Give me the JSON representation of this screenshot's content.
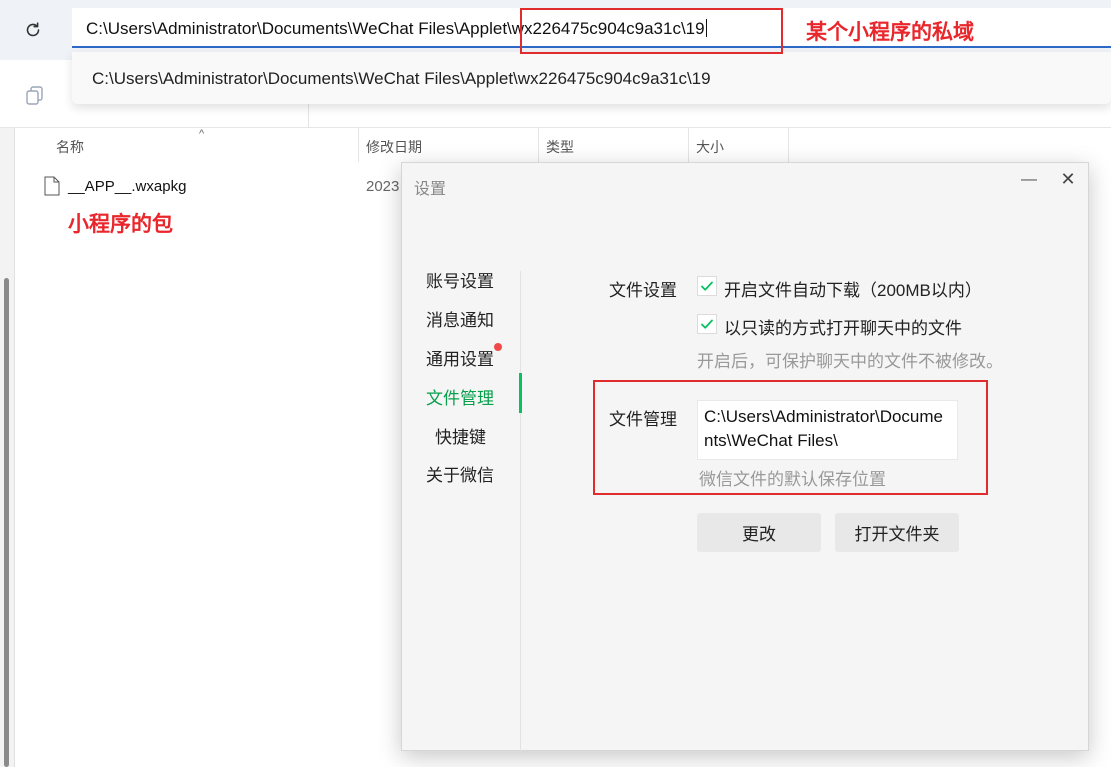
{
  "explorer": {
    "address_path": "C:\\Users\\Administrator\\Documents\\WeChat Files\\Applet\\wx226475c904c9a31c\\19",
    "suggestion_path": "C:\\Users\\Administrator\\Documents\\WeChat Files\\Applet\\wx226475c904c9a31c\\19",
    "columns": {
      "name": "名称",
      "modified": "修改日期",
      "type": "类型",
      "size": "大小"
    },
    "files": [
      {
        "name": "__APP__.wxapkg",
        "date": "2023"
      }
    ]
  },
  "annotations": {
    "address_note": "某个小程序的私域",
    "package_note": "小程序的包",
    "color": "#e8262b"
  },
  "dialog": {
    "title": "设置",
    "nav": [
      {
        "label": "账号设置"
      },
      {
        "label": "消息通知"
      },
      {
        "label": "通用设置"
      },
      {
        "label": "文件管理"
      },
      {
        "label": "快捷键"
      },
      {
        "label": "关于微信"
      }
    ],
    "active_nav": "文件管理",
    "file_settings": {
      "label": "文件设置",
      "auto_download": {
        "label": "开启文件自动下载（200MB以内）",
        "checked": true
      },
      "readonly_open": {
        "label": "以只读的方式打开聊天中的文件",
        "checked": true
      },
      "readonly_hint": "开启后，可保护聊天中的文件不被修改。"
    },
    "file_management": {
      "label": "文件管理",
      "path": "C:\\Users\\Administrator\\Documents\\WeChat Files\\",
      "hint": "微信文件的默认保存位置",
      "change_button": "更改",
      "open_folder_button": "打开文件夹"
    },
    "accent_color": "#07c160"
  }
}
